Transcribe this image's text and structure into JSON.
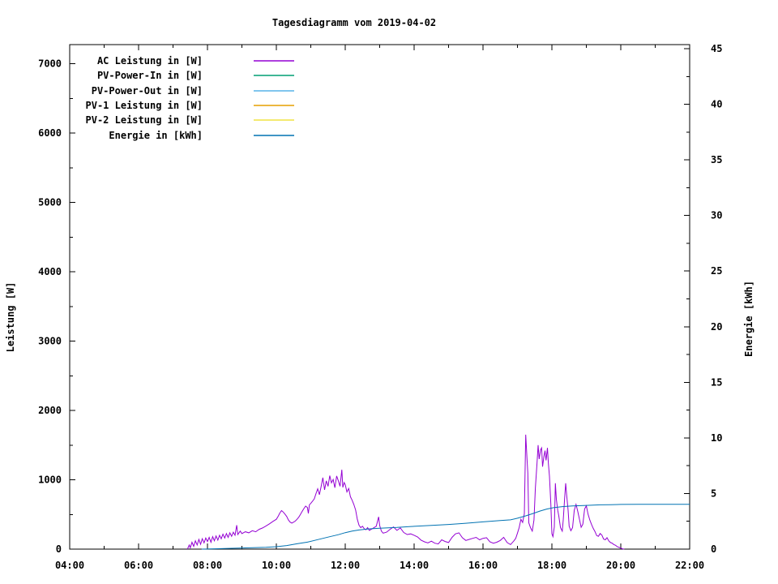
{
  "title": "Tagesdiagramm vom 2019-04-02",
  "axes": {
    "x": {
      "major_hours": [
        4,
        6,
        8,
        10,
        12,
        14,
        16,
        18,
        20,
        22
      ],
      "major_labels": [
        "04:00",
        "06:00",
        "08:00",
        "10:00",
        "12:00",
        "14:00",
        "16:00",
        "18:00",
        "20:00",
        "22:00"
      ],
      "minor_hours": [
        5,
        7,
        9,
        11,
        13,
        15,
        17,
        19,
        21
      ]
    },
    "left": {
      "label": "Leistung [W]",
      "major_values": [
        0,
        1000,
        2000,
        3000,
        4000,
        5000,
        6000,
        7000
      ],
      "major_labels": [
        "0",
        "1000",
        "2000",
        "3000",
        "4000",
        "5000",
        "6000",
        "7000"
      ],
      "minor_values": [
        500,
        1500,
        2500,
        3500,
        4500,
        5500,
        6500
      ]
    },
    "right": {
      "label": "Energie [kWh]",
      "major_values": [
        0,
        5,
        10,
        15,
        20,
        25,
        30,
        35,
        40,
        45
      ],
      "major_labels": [
        "0",
        "5",
        "10",
        "15",
        "20",
        "25",
        "30",
        "35",
        "40",
        "45"
      ],
      "minor_values": [
        2.5,
        7.5,
        12.5,
        17.5,
        22.5,
        27.5,
        32.5,
        37.5,
        42.5
      ]
    }
  },
  "legend": [
    {
      "label": "AC Leistung in [W]",
      "color": "#9400d3"
    },
    {
      "label": "PV-Power-In in [W]",
      "color": "#009e73"
    },
    {
      "label": "PV-Power-Out in [W]",
      "color": "#56b4e9"
    },
    {
      "label": "PV-1 Leistung in [W]",
      "color": "#e69f00"
    },
    {
      "label": "PV-2 Leistung in [W]",
      "color": "#f0e442"
    },
    {
      "label": "Energie in [kWh]",
      "color": "#0072b2"
    }
  ],
  "chart_data": {
    "type": "line",
    "title": "Tagesdiagramm vom 2019-04-02",
    "x_unit": "hour_of_day",
    "xlim": [
      4,
      22
    ],
    "ylabel": "Leistung [W]",
    "ylim": [
      0,
      7200
    ],
    "y2label": "Energie [kWh]",
    "y2lim": [
      0,
      45
    ],
    "grid": false,
    "legend_position": "top-left",
    "series": [
      {
        "name": "AC Leistung in [W]",
        "color": "#9400d3",
        "axis": "left",
        "unit": "W",
        "points": [
          [
            7.42,
            0
          ],
          [
            7.47,
            60
          ],
          [
            7.5,
            20
          ],
          [
            7.55,
            100
          ],
          [
            7.6,
            40
          ],
          [
            7.65,
            120
          ],
          [
            7.7,
            60
          ],
          [
            7.75,
            140
          ],
          [
            7.8,
            70
          ],
          [
            7.85,
            150
          ],
          [
            7.9,
            90
          ],
          [
            7.95,
            160
          ],
          [
            8.0,
            110
          ],
          [
            8.05,
            170
          ],
          [
            8.1,
            100
          ],
          [
            8.15,
            180
          ],
          [
            8.2,
            120
          ],
          [
            8.25,
            190
          ],
          [
            8.3,
            130
          ],
          [
            8.35,
            200
          ],
          [
            8.4,
            150
          ],
          [
            8.45,
            215
          ],
          [
            8.5,
            160
          ],
          [
            8.55,
            225
          ],
          [
            8.6,
            170
          ],
          [
            8.65,
            235
          ],
          [
            8.7,
            185
          ],
          [
            8.75,
            245
          ],
          [
            8.8,
            200
          ],
          [
            8.85,
            345
          ],
          [
            8.88,
            210
          ],
          [
            8.95,
            260
          ],
          [
            9.0,
            225
          ],
          [
            9.1,
            250
          ],
          [
            9.2,
            235
          ],
          [
            9.3,
            265
          ],
          [
            9.4,
            250
          ],
          [
            9.5,
            285
          ],
          [
            9.6,
            305
          ],
          [
            9.7,
            335
          ],
          [
            9.8,
            365
          ],
          [
            9.9,
            400
          ],
          [
            10.0,
            430
          ],
          [
            10.05,
            470
          ],
          [
            10.1,
            520
          ],
          [
            10.15,
            555
          ],
          [
            10.2,
            535
          ],
          [
            10.25,
            505
          ],
          [
            10.3,
            470
          ],
          [
            10.35,
            420
          ],
          [
            10.4,
            390
          ],
          [
            10.45,
            375
          ],
          [
            10.5,
            390
          ],
          [
            10.55,
            405
          ],
          [
            10.6,
            430
          ],
          [
            10.65,
            460
          ],
          [
            10.7,
            500
          ],
          [
            10.75,
            545
          ],
          [
            10.8,
            585
          ],
          [
            10.85,
            620
          ],
          [
            10.9,
            600
          ],
          [
            10.93,
            515
          ],
          [
            10.96,
            640
          ],
          [
            11.0,
            660
          ],
          [
            11.05,
            690
          ],
          [
            11.1,
            725
          ],
          [
            11.15,
            800
          ],
          [
            11.2,
            870
          ],
          [
            11.25,
            785
          ],
          [
            11.3,
            905
          ],
          [
            11.35,
            1030
          ],
          [
            11.4,
            855
          ],
          [
            11.45,
            985
          ],
          [
            11.5,
            905
          ],
          [
            11.55,
            1060
          ],
          [
            11.6,
            955
          ],
          [
            11.65,
            1005
          ],
          [
            11.7,
            885
          ],
          [
            11.75,
            1055
          ],
          [
            11.8,
            985
          ],
          [
            11.85,
            905
          ],
          [
            11.9,
            1145
          ],
          [
            11.93,
            890
          ],
          [
            11.97,
            960
          ],
          [
            12.0,
            930
          ],
          [
            12.05,
            825
          ],
          [
            12.1,
            875
          ],
          [
            12.15,
            755
          ],
          [
            12.2,
            705
          ],
          [
            12.25,
            645
          ],
          [
            12.3,
            565
          ],
          [
            12.35,
            430
          ],
          [
            12.4,
            345
          ],
          [
            12.45,
            310
          ],
          [
            12.5,
            330
          ],
          [
            12.55,
            295
          ],
          [
            12.6,
            280
          ],
          [
            12.65,
            310
          ],
          [
            12.7,
            270
          ],
          [
            12.8,
            300
          ],
          [
            12.9,
            330
          ],
          [
            12.97,
            465
          ],
          [
            13.0,
            340
          ],
          [
            13.05,
            260
          ],
          [
            13.1,
            230
          ],
          [
            13.2,
            245
          ],
          [
            13.3,
            285
          ],
          [
            13.4,
            320
          ],
          [
            13.5,
            270
          ],
          [
            13.6,
            305
          ],
          [
            13.7,
            240
          ],
          [
            13.8,
            210
          ],
          [
            13.9,
            220
          ],
          [
            14.0,
            200
          ],
          [
            14.1,
            175
          ],
          [
            14.2,
            130
          ],
          [
            14.3,
            105
          ],
          [
            14.4,
            90
          ],
          [
            14.5,
            115
          ],
          [
            14.6,
            85
          ],
          [
            14.7,
            75
          ],
          [
            14.8,
            135
          ],
          [
            14.9,
            110
          ],
          [
            15.0,
            95
          ],
          [
            15.1,
            170
          ],
          [
            15.2,
            220
          ],
          [
            15.3,
            235
          ],
          [
            15.4,
            165
          ],
          [
            15.5,
            125
          ],
          [
            15.6,
            140
          ],
          [
            15.7,
            155
          ],
          [
            15.8,
            170
          ],
          [
            15.9,
            135
          ],
          [
            16.0,
            155
          ],
          [
            16.1,
            165
          ],
          [
            16.2,
            105
          ],
          [
            16.3,
            85
          ],
          [
            16.4,
            100
          ],
          [
            16.5,
            125
          ],
          [
            16.6,
            170
          ],
          [
            16.7,
            95
          ],
          [
            16.8,
            65
          ],
          [
            16.9,
            120
          ],
          [
            16.95,
            155
          ],
          [
            17.0,
            230
          ],
          [
            17.05,
            310
          ],
          [
            17.1,
            430
          ],
          [
            17.15,
            385
          ],
          [
            17.2,
            510
          ],
          [
            17.24,
            1650
          ],
          [
            17.28,
            1280
          ],
          [
            17.3,
            1100
          ],
          [
            17.33,
            380
          ],
          [
            17.38,
            310
          ],
          [
            17.43,
            260
          ],
          [
            17.48,
            420
          ],
          [
            17.52,
            880
          ],
          [
            17.57,
            1250
          ],
          [
            17.6,
            1500
          ],
          [
            17.63,
            1300
          ],
          [
            17.67,
            1430
          ],
          [
            17.7,
            1460
          ],
          [
            17.73,
            1190
          ],
          [
            17.77,
            1340
          ],
          [
            17.8,
            1420
          ],
          [
            17.83,
            1280
          ],
          [
            17.87,
            1460
          ],
          [
            17.9,
            1230
          ],
          [
            17.93,
            1050
          ],
          [
            17.97,
            650
          ],
          [
            18.0,
            220
          ],
          [
            18.03,
            180
          ],
          [
            18.07,
            320
          ],
          [
            18.1,
            950
          ],
          [
            18.13,
            720
          ],
          [
            18.17,
            560
          ],
          [
            18.2,
            480
          ],
          [
            18.25,
            310
          ],
          [
            18.3,
            260
          ],
          [
            18.33,
            420
          ],
          [
            18.37,
            730
          ],
          [
            18.4,
            950
          ],
          [
            18.43,
            770
          ],
          [
            18.47,
            560
          ],
          [
            18.5,
            330
          ],
          [
            18.55,
            265
          ],
          [
            18.6,
            310
          ],
          [
            18.65,
            560
          ],
          [
            18.7,
            645
          ],
          [
            18.75,
            545
          ],
          [
            18.8,
            430
          ],
          [
            18.85,
            315
          ],
          [
            18.9,
            360
          ],
          [
            18.95,
            580
          ],
          [
            19.0,
            625
          ],
          [
            19.05,
            505
          ],
          [
            19.1,
            420
          ],
          [
            19.15,
            355
          ],
          [
            19.2,
            300
          ],
          [
            19.25,
            255
          ],
          [
            19.3,
            195
          ],
          [
            19.35,
            185
          ],
          [
            19.4,
            225
          ],
          [
            19.45,
            205
          ],
          [
            19.5,
            145
          ],
          [
            19.55,
            135
          ],
          [
            19.6,
            165
          ],
          [
            19.65,
            120
          ],
          [
            19.7,
            95
          ],
          [
            19.75,
            85
          ],
          [
            19.8,
            65
          ],
          [
            19.85,
            55
          ],
          [
            19.9,
            35
          ],
          [
            19.95,
            25
          ],
          [
            20.0,
            15
          ],
          [
            20.05,
            5
          ],
          [
            20.1,
            0
          ]
        ]
      },
      {
        "name": "PV-Power-In in [W]",
        "color": "#009e73",
        "axis": "left",
        "unit": "W",
        "points": []
      },
      {
        "name": "PV-Power-Out in [W]",
        "color": "#56b4e9",
        "axis": "left",
        "unit": "W",
        "points": []
      },
      {
        "name": "PV-1 Leistung in [W]",
        "color": "#e69f00",
        "axis": "left",
        "unit": "W",
        "points": []
      },
      {
        "name": "PV-2 Leistung in [W]",
        "color": "#f0e442",
        "axis": "left",
        "unit": "W",
        "points": []
      },
      {
        "name": "Energie in [kWh]",
        "color": "#0072b2",
        "axis": "right",
        "unit": "kWh",
        "points": [
          [
            7.83,
            0
          ],
          [
            8.2,
            0.03
          ],
          [
            8.7,
            0.07
          ],
          [
            9.2,
            0.12
          ],
          [
            9.7,
            0.17
          ],
          [
            10.0,
            0.22
          ],
          [
            10.3,
            0.32
          ],
          [
            10.6,
            0.48
          ],
          [
            10.9,
            0.63
          ],
          [
            11.2,
            0.85
          ],
          [
            11.5,
            1.08
          ],
          [
            11.8,
            1.3
          ],
          [
            12.0,
            1.48
          ],
          [
            12.2,
            1.62
          ],
          [
            12.4,
            1.72
          ],
          [
            12.7,
            1.82
          ],
          [
            13.0,
            1.88
          ],
          [
            13.5,
            1.95
          ],
          [
            14.0,
            2.05
          ],
          [
            14.5,
            2.13
          ],
          [
            15.0,
            2.22
          ],
          [
            15.5,
            2.33
          ],
          [
            16.0,
            2.45
          ],
          [
            16.5,
            2.57
          ],
          [
            16.8,
            2.63
          ],
          [
            17.0,
            2.78
          ],
          [
            17.25,
            3.0
          ],
          [
            17.45,
            3.2
          ],
          [
            17.65,
            3.42
          ],
          [
            17.85,
            3.6
          ],
          [
            18.05,
            3.73
          ],
          [
            18.3,
            3.82
          ],
          [
            18.6,
            3.88
          ],
          [
            19.0,
            3.93
          ],
          [
            19.4,
            3.98
          ],
          [
            19.7,
            4.0
          ],
          [
            20.0,
            4.02
          ],
          [
            20.5,
            4.03
          ],
          [
            21.0,
            4.03
          ],
          [
            22.0,
            4.03
          ]
        ]
      }
    ]
  }
}
